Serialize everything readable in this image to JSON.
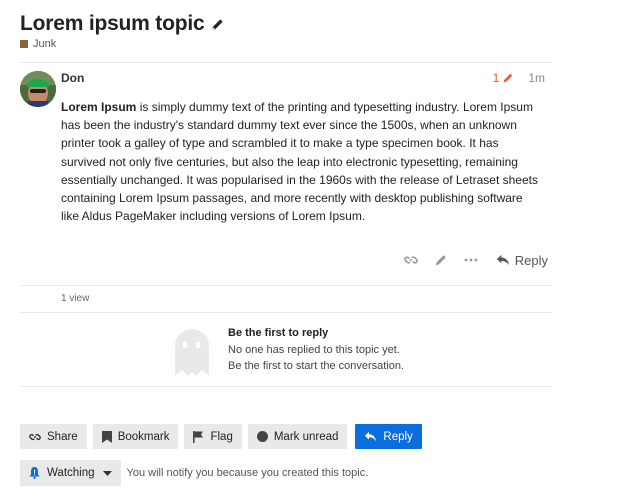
{
  "topic": {
    "title": "Lorem ipsum topic",
    "category": "Junk",
    "category_color": "#8c6238"
  },
  "post": {
    "username": "Don",
    "edit_count": "1",
    "age": "1m",
    "body_bold": "Lorem Ipsum",
    "body_text": " is simply dummy text of the printing and typesetting industry. Lorem Ipsum has been the industry's standard dummy text ever since the 1500s, when an unknown printer took a galley of type and scrambled it to make a type specimen book. It has survived not only five centuries, but also the leap into electronic typesetting, remaining essentially unchanged. It was popularised in the 1960s with the release of Letraset sheets containing Lorem Ipsum passages, and more recently with desktop publishing software like Aldus PageMaker including versions of Lorem Ipsum.",
    "reply_label": "Reply",
    "views": "1 view"
  },
  "empty_state": {
    "title": "Be the first to reply",
    "line1": "No one has replied to this topic yet.",
    "line2": "Be the first to start the conversation."
  },
  "footer_buttons": {
    "share": "Share",
    "bookmark": "Bookmark",
    "flag": "Flag",
    "mark_unread": "Mark unread",
    "reply": "Reply"
  },
  "notifications": {
    "level": "Watching",
    "description": "You will notify you because you created this topic."
  },
  "colors": {
    "accent": "#0a6fdc",
    "edit_highlight": "#e45735"
  },
  "icons": [
    "pencil-icon",
    "link-icon",
    "ellipsis-icon",
    "reply-icon",
    "bookmark-icon",
    "flag-icon",
    "circle-icon",
    "bell-icon",
    "caret-down-icon",
    "ghost-icon"
  ]
}
